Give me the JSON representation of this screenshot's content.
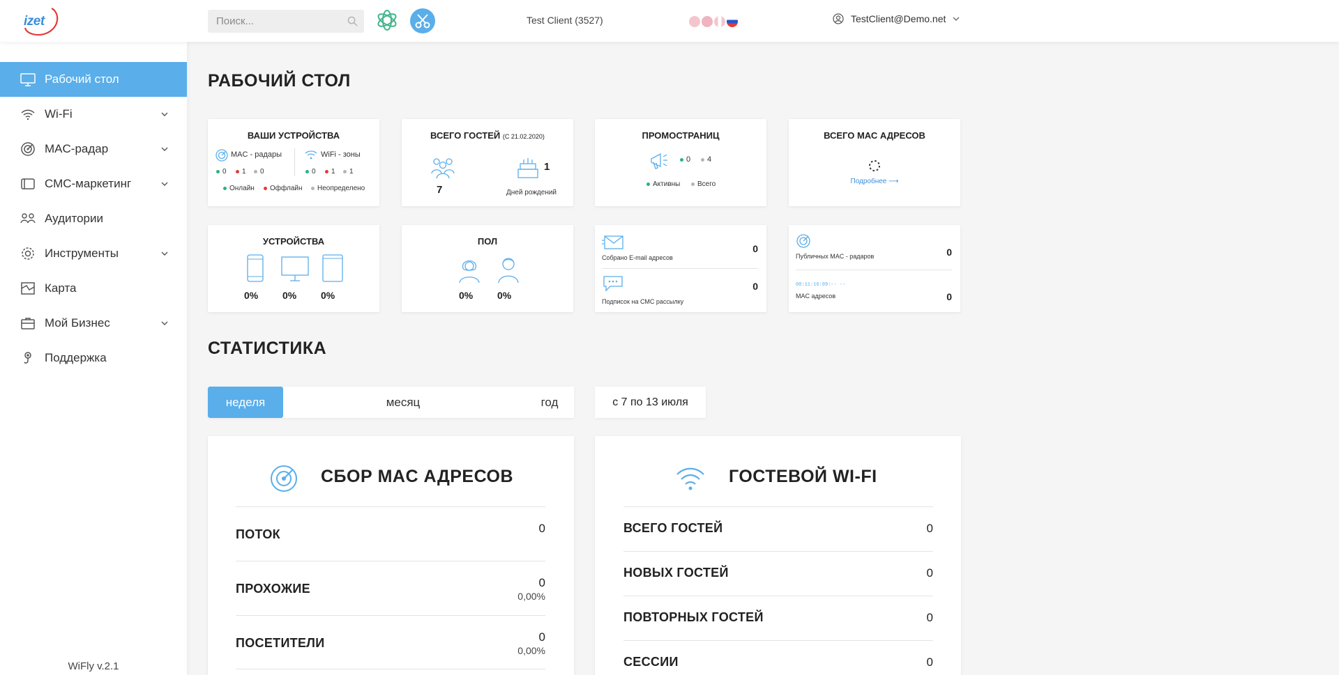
{
  "header": {
    "logo_text": "izet",
    "search_placeholder": "Поиск...",
    "client": "Test Client (3527)",
    "user_email": "TestClient@Demo.net"
  },
  "sidebar": {
    "items": [
      {
        "label": "Рабочий стол",
        "icon": "monitor-icon"
      },
      {
        "label": "Wi-Fi",
        "icon": "wifi-icon"
      },
      {
        "label": "MAC-радар",
        "icon": "radar-icon"
      },
      {
        "label": "СМС-маркетинг",
        "icon": "phone-icon"
      },
      {
        "label": "Аудитории",
        "icon": "people-icon"
      },
      {
        "label": "Инструменты",
        "icon": "gear-icon"
      },
      {
        "label": "Карта",
        "icon": "map-icon"
      },
      {
        "label": "Мой Бизнес",
        "icon": "briefcase-icon"
      },
      {
        "label": "Поддержка",
        "icon": "support-icon"
      }
    ],
    "version": "WiFly v.2.1"
  },
  "page_title": "РАБОЧИЙ СТОЛ",
  "cards": {
    "devices": {
      "title": "ВАШИ УСТРОЙСТВА",
      "mac_label": "MAC - радары",
      "wifi_label": "WiFi - зоны",
      "mac_online": "0",
      "mac_offline": "1",
      "mac_unknown": "0",
      "wifi_online": "0",
      "wifi_offline": "1",
      "wifi_unknown": "1",
      "legend_online": "Онлайн",
      "legend_offline": "Оффлайн",
      "legend_unknown": "Неопределено"
    },
    "guests": {
      "title": "ВСЕГО ГОСТЕЙ",
      "since": "(с 21.02.2020)",
      "total": "7",
      "birthdays": "1",
      "birthdays_label": "Дней рождений"
    },
    "promo": {
      "title": "ПРОМОСТРАНИЦ",
      "active": "0",
      "total": "4",
      "active_label": "Активны",
      "total_label": "Всего"
    },
    "mac_total": {
      "title": "ВСЕГО МАС АДРЕСОВ",
      "more": "Подробнее ⟶"
    },
    "device_types": {
      "title": "УСТРОЙСТВА",
      "phone": "0%",
      "desktop": "0%",
      "tablet": "0%"
    },
    "gender": {
      "title": "ПОЛ",
      "female": "0%",
      "male": "0%"
    },
    "collected": {
      "email_label": "Собрано E-mail адресов",
      "email_value": "0",
      "sms_label": "Подписок на СМС рассылку",
      "sms_value": "0"
    },
    "public_mac": {
      "radar_label": "Публичных MAC - радаров",
      "radar_value": "0",
      "mac_sample": "00:11:16:09:-- --",
      "mac_label": "MAC адресов",
      "mac_value": "0"
    }
  },
  "stats": {
    "title": "СТАТИСТИКА",
    "tabs": [
      "неделя",
      "месяц",
      "год"
    ],
    "date_range": "с 7 по 13 июля"
  },
  "mac_panel": {
    "title": "СБОР MAC АДРЕСОВ",
    "rows": [
      {
        "label": "ПОТОК",
        "value": "0",
        "sub": ""
      },
      {
        "label": "ПРОХОЖИЕ",
        "value": "0",
        "sub": "0,00%"
      },
      {
        "label": "ПОСЕТИТЕЛИ",
        "value": "0",
        "sub": "0,00%"
      }
    ]
  },
  "wifi_panel": {
    "title": "ГОСТЕВОЙ WI-FI",
    "rows": [
      {
        "label": "ВСЕГО ГОСТЕЙ",
        "value": "0"
      },
      {
        "label": "НОВЫХ ГОСТЕЙ",
        "value": "0"
      },
      {
        "label": "ПОВТОРНЫХ ГОСТЕЙ",
        "value": "0"
      },
      {
        "label": "СЕССИИ",
        "value": "0"
      }
    ]
  },
  "colors": {
    "accent": "#5aaeea",
    "online": "#29b47a",
    "offline": "#e23b3b",
    "unknown": "#b5b5b5"
  }
}
